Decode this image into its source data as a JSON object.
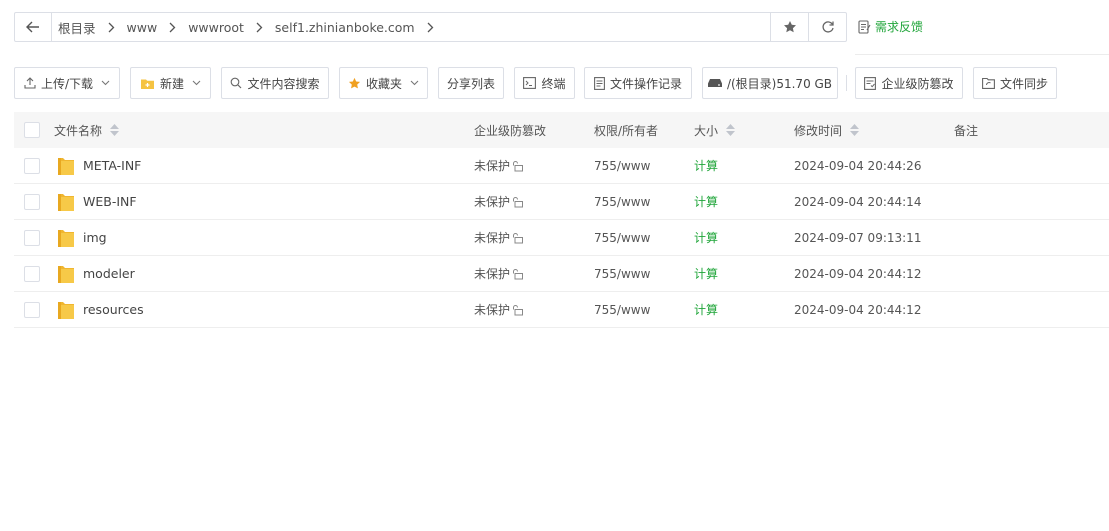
{
  "addressbar": {
    "crumbs": [
      "根目录",
      "www",
      "wwwroot",
      "self1.zhinianboke.com"
    ]
  },
  "feedback": {
    "label": "需求反馈"
  },
  "toolbar": {
    "upload_download": "上传/下载",
    "new": "新建",
    "content_search": "文件内容搜索",
    "favorites": "收藏夹",
    "share_list": "分享列表",
    "terminal": "终端",
    "op_log": "文件操作记录",
    "disk": "/(根目录)51.70 GB",
    "tamper_protect": "企业级防篡改",
    "file_sync": "文件同步"
  },
  "table": {
    "headers": {
      "name": "文件名称",
      "protect": "企业级防篡改",
      "perm": "权限/所有者",
      "size": "大小",
      "mtime": "修改时间",
      "note": "备注"
    },
    "rows": [
      {
        "name": "META-INF",
        "protect": "未保护",
        "perm": "755/www",
        "size": "计算",
        "mtime": "2024-09-04 20:44:26",
        "note": ""
      },
      {
        "name": "WEB-INF",
        "protect": "未保护",
        "perm": "755/www",
        "size": "计算",
        "mtime": "2024-09-04 20:44:14",
        "note": ""
      },
      {
        "name": "img",
        "protect": "未保护",
        "perm": "755/www",
        "size": "计算",
        "mtime": "2024-09-07 09:13:11",
        "note": ""
      },
      {
        "name": "modeler",
        "protect": "未保护",
        "perm": "755/www",
        "size": "计算",
        "mtime": "2024-09-04 20:44:12",
        "note": ""
      },
      {
        "name": "resources",
        "protect": "未保护",
        "perm": "755/www",
        "size": "计算",
        "mtime": "2024-09-04 20:44:12",
        "note": ""
      }
    ]
  },
  "colors": {
    "accent": "#20a53a",
    "folder": "#f5c342",
    "border": "#dcdfe6"
  }
}
